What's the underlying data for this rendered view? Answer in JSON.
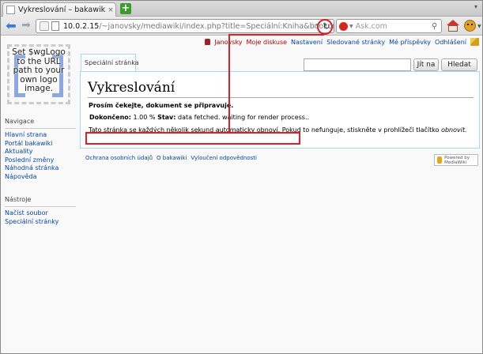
{
  "browser": {
    "tab_title": "Vykreslování – bakawiki",
    "tab_close": "×",
    "new_tab": "+",
    "url_host": "10.0.2.15",
    "url_path": "/~janovsky/mediawiki/index.php?title=Speciální:Kniha&bookcmd=",
    "url_star": "☆",
    "search_placeholder": "Ask.com"
  },
  "logo": {
    "text": "Set $wgLogo to the URL path to your own logo image."
  },
  "personal": {
    "user": "Janovsky",
    "items": [
      "Moje diskuse",
      "Nastavení",
      "Sledované stránky",
      "Mé příspěvky",
      "Odhlášení"
    ]
  },
  "tabs": {
    "special": "Speciální stránka"
  },
  "search": {
    "go_label": "Jít na",
    "find_label": "Hledat"
  },
  "content": {
    "title": "Vykreslování",
    "wait_message": "Prosím čekejte, dokument se připravuje.",
    "status_done_label": "Dokončeno:",
    "status_done_value": "1.00 %",
    "status_state_label": "Stav:",
    "status_state_value": "data fetched. waiting for render process..",
    "refresh_note": "Tato stránka se každých několik sekund automaticky obnoví. Pokud to nefunguje, stiskněte v prohlížeči tlačítko",
    "refresh_note_action": "obnovit."
  },
  "sidebar": {
    "navigation_title": "Navigace",
    "navigation_items": [
      "Hlavní strana",
      "Portál bakawiki",
      "Aktuality",
      "Poslední změny",
      "Náhodná stránka",
      "Nápověda"
    ],
    "tools_title": "Nástroje",
    "tools_items": [
      "Načíst soubor",
      "Speciální stránky"
    ]
  },
  "footer": {
    "links": [
      "Ochrana osobních údajů",
      "O bakawiki",
      "Vyloučení odpovědnosti"
    ],
    "powered_by": "Powered by MediaWiki"
  },
  "colors": {
    "highlight": "#d8222a",
    "link": "#0645ad",
    "border": "#a7d7f9"
  }
}
